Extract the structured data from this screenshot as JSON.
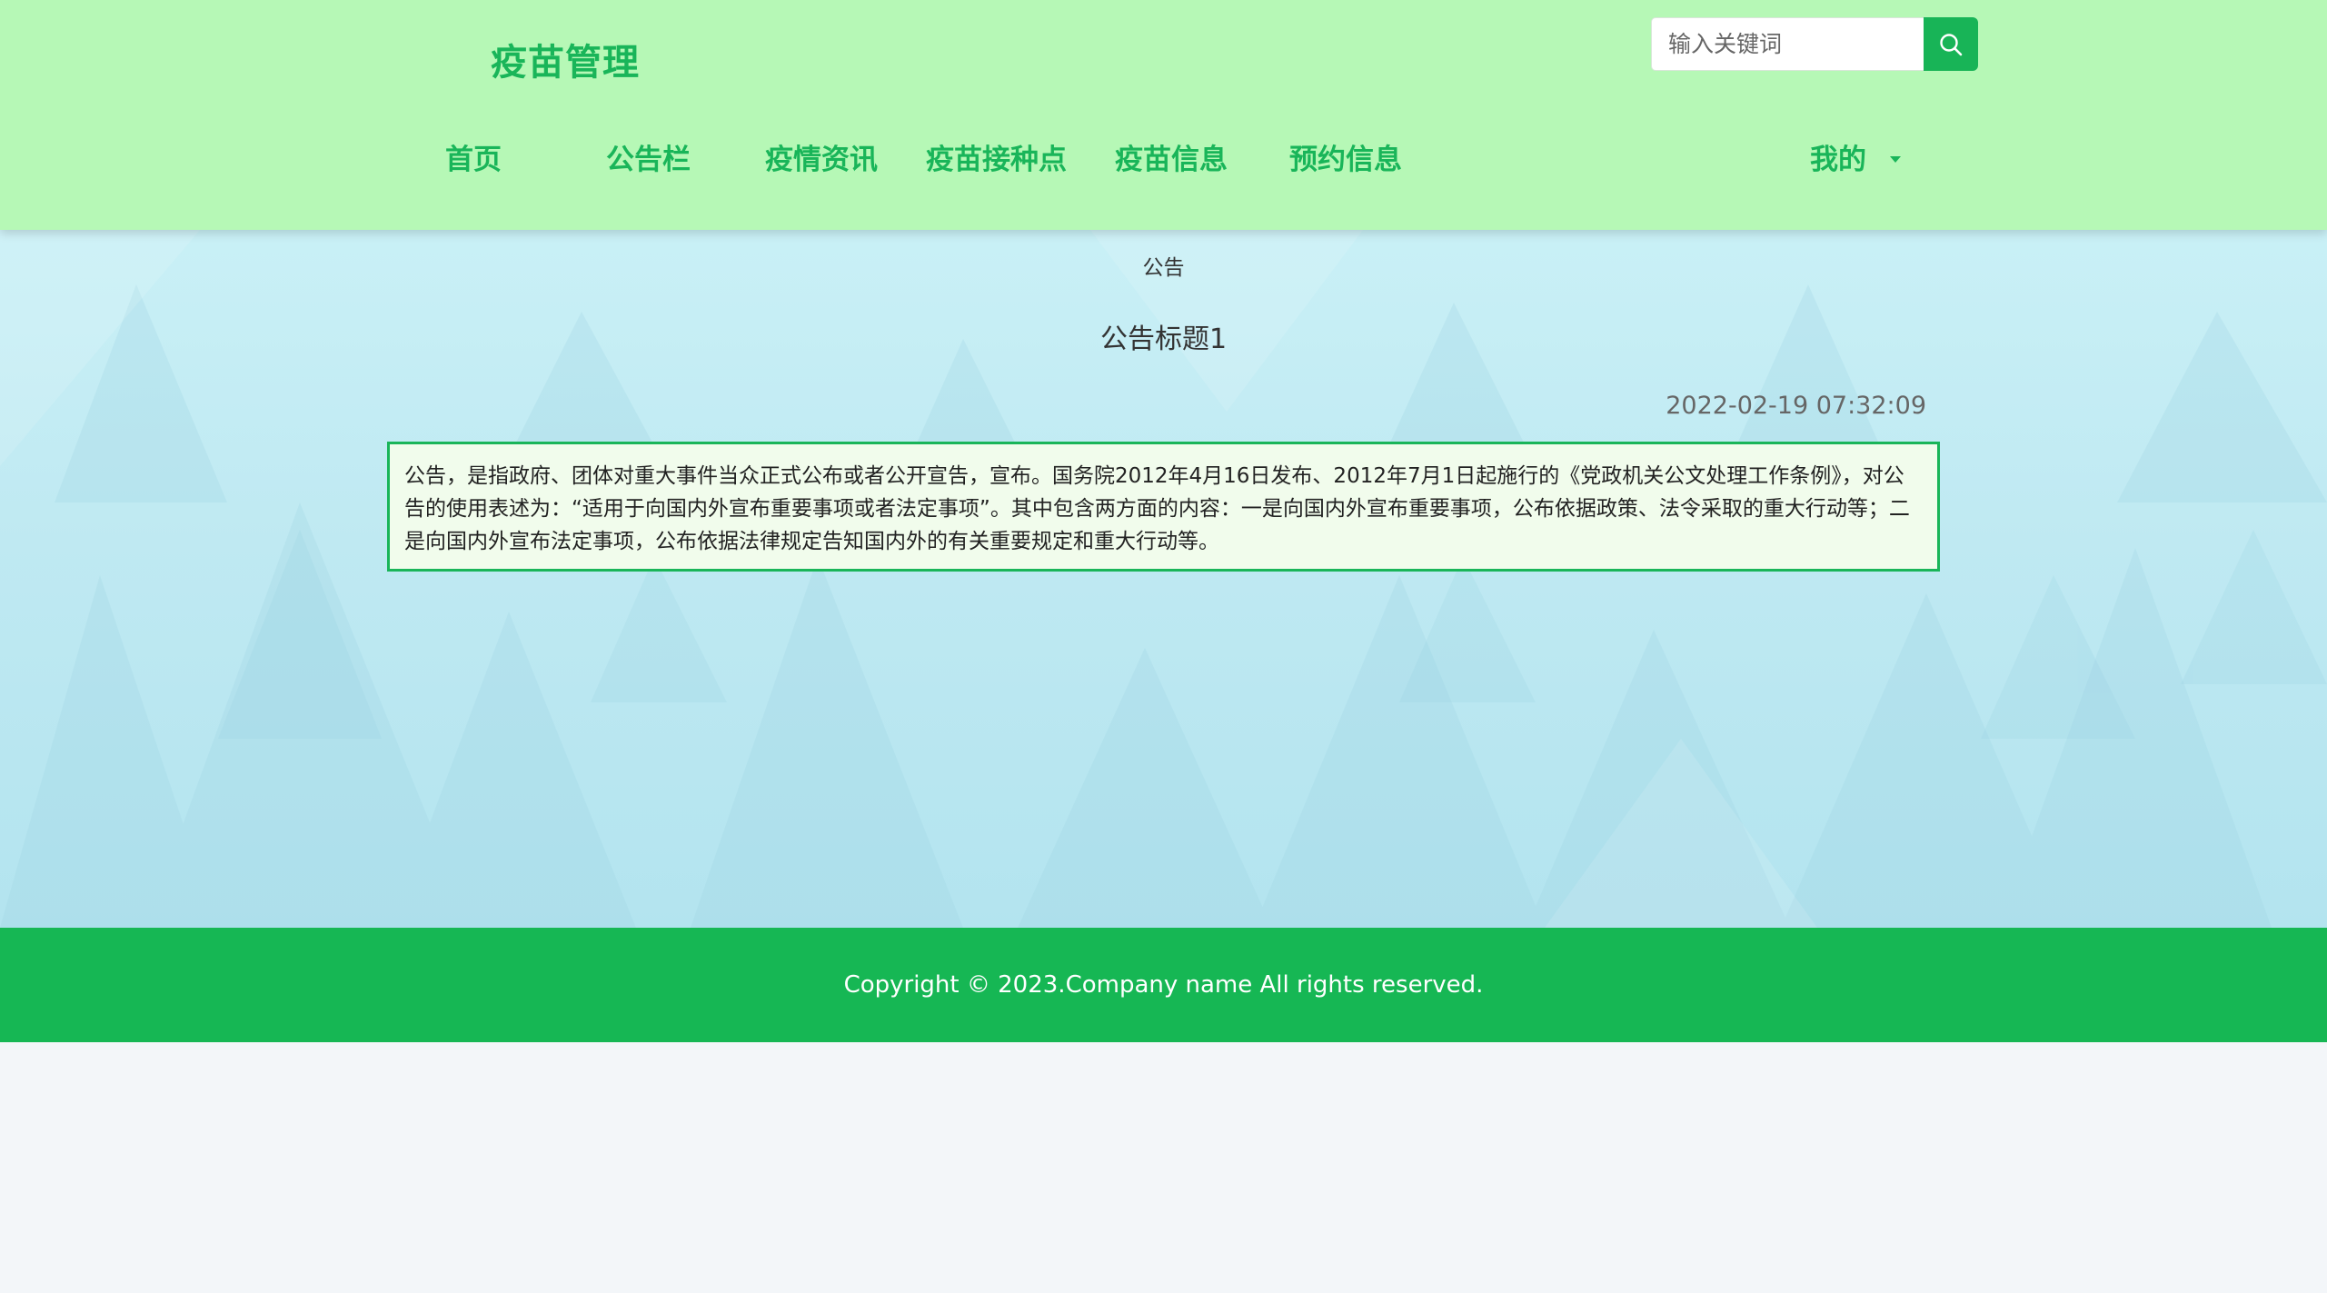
{
  "header": {
    "logo": "疫苗管理",
    "search": {
      "placeholder": "输入关键词",
      "value": ""
    },
    "nav": {
      "home": "首页",
      "bulletin": "公告栏",
      "epidemic_news": "疫情资讯",
      "vaccination_sites": "疫苗接种点",
      "vaccine_info": "疫苗信息",
      "appointment_info": "预约信息",
      "mine": "我的"
    }
  },
  "main": {
    "section_label": "公告",
    "notice": {
      "title": "公告标题1",
      "date": "2022-02-19 07:32:09",
      "content": "公告，是指政府、团体对重大事件当众正式公布或者公开宣告，宣布。国务院2012年4月16日发布、2012年7月1日起施行的《党政机关公文处理工作条例》，对公告的使用表述为：“适用于向国内外宣布重要事项或者法定事项”。其中包含两方面的内容：一是向国内外宣布重要事项，公布依据政策、法令采取的重大行动等；二是向国内外宣布法定事项，公布依据法律规定告知国内外的有关重要规定和重大行动等。"
    }
  },
  "footer": {
    "copyright": "Copyright © 2023.Company name All rights reserved."
  },
  "colors": {
    "header_bg": "#b6f8b6",
    "accent": "#19b559",
    "footer_bg": "#16b754",
    "notice_bg": "#f1fcec"
  },
  "icons": {
    "search": "search-icon",
    "dropdown": "caret-down-icon"
  }
}
